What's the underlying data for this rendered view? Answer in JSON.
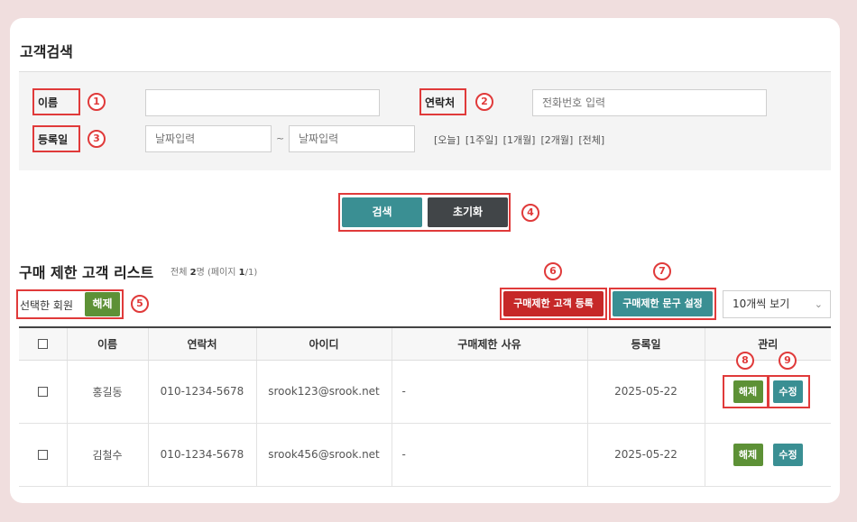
{
  "search": {
    "title": "고객검색",
    "name_label": "이름",
    "name_value": "",
    "contact_label": "연락처",
    "contact_placeholder": "전화번호 입력",
    "regdate_label": "등록일",
    "date_from_placeholder": "날짜입력",
    "date_sep": "~",
    "date_to_placeholder": "날짜입력",
    "quick_dates": [
      "[오늘]",
      "[1주일]",
      "[1개월]",
      "[2개월]",
      "[전체]"
    ],
    "search_button": "검색",
    "reset_button": "초기화"
  },
  "list": {
    "title": "구매 제한 고객 리스트",
    "total_prefix": "전체 ",
    "total_count": "2",
    "total_mid": "명 (페이지 ",
    "page_current": "1",
    "page_total": "/1)",
    "selected_label": "선택한 회원",
    "release_button": "해제",
    "register_button": "구매제한 고객 등록",
    "message_button": "구매제한 문구 설정",
    "page_size": "10개씩 보기",
    "columns": [
      "이름",
      "연락처",
      "아이디",
      "구매제한 사유",
      "등록일",
      "관리"
    ],
    "rows": [
      {
        "name": "홍길동",
        "phone": "010-1234-5678",
        "id": "srook123@srook.net",
        "reason": "-",
        "date": "2025-05-22",
        "release": "해제",
        "edit": "수정"
      },
      {
        "name": "김철수",
        "phone": "010-1234-5678",
        "id": "srook456@srook.net",
        "reason": "-",
        "date": "2025-05-22",
        "release": "해제",
        "edit": "수정"
      }
    ]
  },
  "markers": [
    "1",
    "2",
    "3",
    "4",
    "5",
    "6",
    "7",
    "8",
    "9"
  ],
  "colors": {
    "teal": "#3a8f93",
    "dark": "#414548",
    "green": "#5d9136",
    "red": "#c62828",
    "annotation": "#e03a3a",
    "background": "#f0dede"
  }
}
